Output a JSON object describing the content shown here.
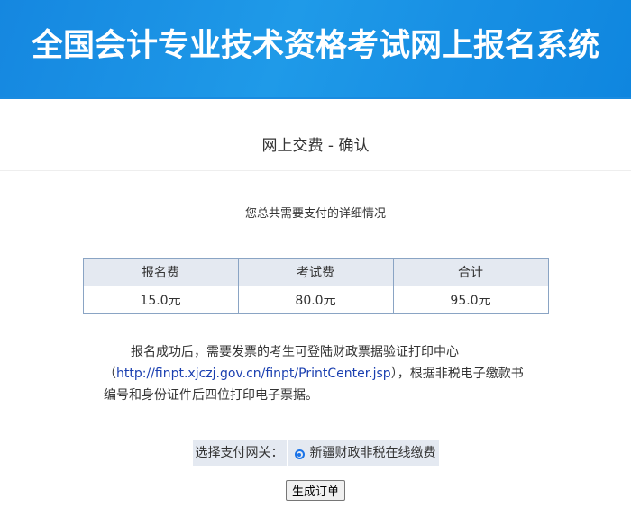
{
  "header": {
    "title": "全国会计专业技术资格考试网上报名系统"
  },
  "page": {
    "title": "网上交费 - 确认",
    "subtitle": "您总共需要支付的详细情况"
  },
  "fees": {
    "headers": [
      "报名费",
      "考试费",
      "合计"
    ],
    "values": [
      "15.0元",
      "80.0元",
      "95.0元"
    ]
  },
  "notice": {
    "before": "报名成功后，需要发票的考生可登陆财政票据验证打印中心（",
    "link": "http://finpt.xjczj.gov.cn/finpt/PrintCenter.jsp",
    "after": "），根据非税电子缴款书编号和身份证件后四位打印电子票据。"
  },
  "gateway": {
    "label": "选择支付网关：",
    "option": "新疆财政非税在线缴费",
    "selected": true
  },
  "actions": {
    "submit": "生成订单"
  }
}
